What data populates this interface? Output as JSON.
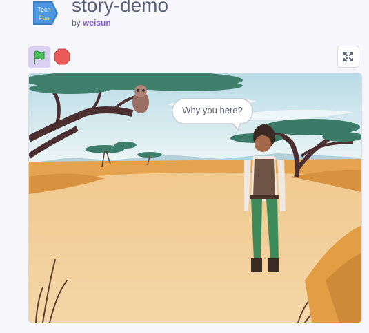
{
  "project": {
    "title": "story-demo",
    "by_label": "by",
    "author": "weisun",
    "thumbnail_text_top": "Tech",
    "thumbnail_text_bottom": "Fun"
  },
  "controls": {
    "green_flag_icon": "green-flag-icon",
    "stop_icon": "stop-sign-icon",
    "fullscreen_icon": "fullscreen-icon"
  },
  "stage": {
    "speech_bubble": "Why you here?",
    "sprites": [
      "girl",
      "owl"
    ],
    "backdrop": "savanna"
  },
  "colors": {
    "title": "#575e75",
    "author": "#855cd6",
    "flag_active_bg": "#d9d0f3",
    "flag_green": "#4cbf56",
    "stop_red": "#ec5959"
  }
}
